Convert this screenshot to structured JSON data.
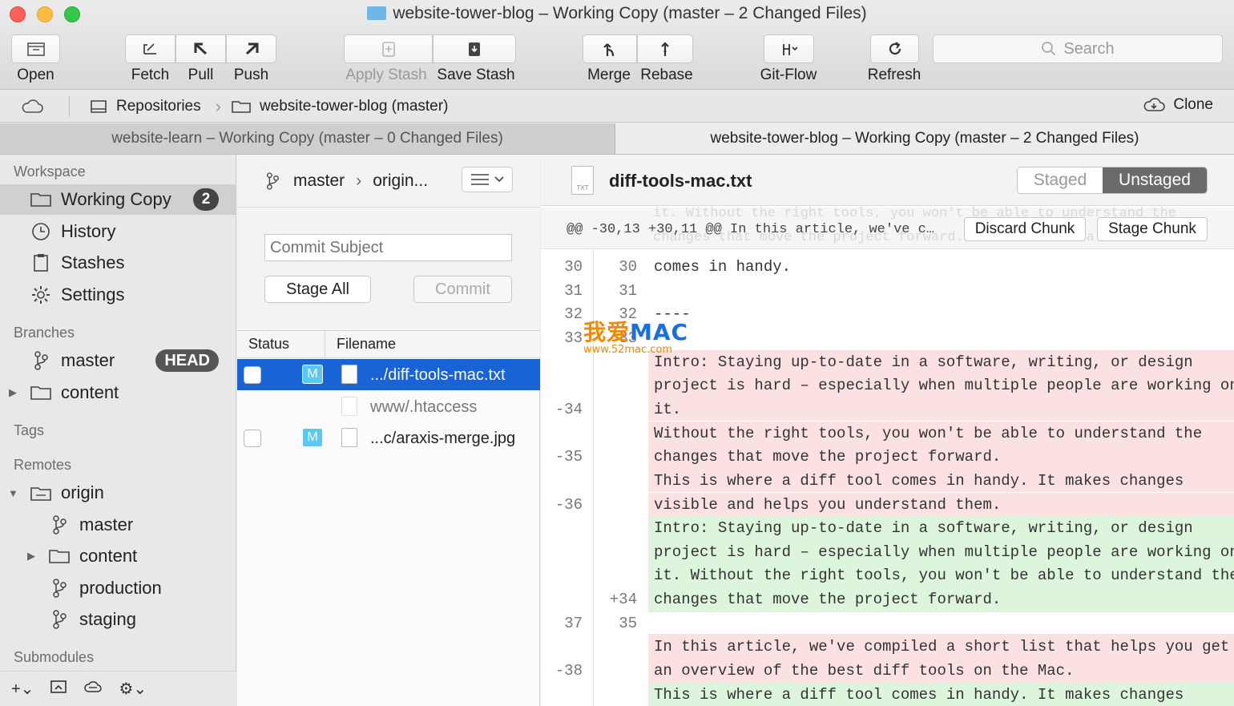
{
  "window": {
    "title": "website-tower-blog – Working Copy (master – 2 Changed Files)"
  },
  "toolbar": {
    "open": "Open",
    "fetch": "Fetch",
    "pull": "Pull",
    "push": "Push",
    "apply_stash": "Apply Stash",
    "save_stash": "Save Stash",
    "merge": "Merge",
    "rebase": "Rebase",
    "gitflow": "Git-Flow",
    "refresh": "Refresh",
    "search_placeholder": "Search"
  },
  "pathbar": {
    "repositories": "Repositories",
    "repo": "website-tower-blog (master)",
    "clone": "Clone"
  },
  "tabs": [
    {
      "label": "website-learn – Working Copy (master – 0 Changed Files)"
    },
    {
      "label": "website-tower-blog – Working Copy (master – 2 Changed Files)"
    }
  ],
  "sidebar": {
    "workspace_header": "Workspace",
    "working_copy": "Working Copy",
    "working_copy_count": "2",
    "history": "History",
    "stashes": "Stashes",
    "settings": "Settings",
    "branches_header": "Branches",
    "branch_master": "master",
    "head_badge": "HEAD",
    "branch_content": "content",
    "tags_header": "Tags",
    "remotes_header": "Remotes",
    "remote_origin": "origin",
    "remote_master": "master",
    "remote_content": "content",
    "remote_production": "production",
    "remote_staging": "staging",
    "submodules_header": "Submodules"
  },
  "middle": {
    "branch": "master",
    "upstream": "origin...",
    "commit_subject_placeholder": "Commit Subject",
    "stage_all": "Stage All",
    "commit": "Commit",
    "col_status": "Status",
    "col_filename": "Filename",
    "files": [
      {
        "status": "M",
        "name": ".../diff-tools-mac.txt"
      },
      {
        "status": "",
        "name": "www/.htaccess"
      },
      {
        "status": "M",
        "name": "...c/araxis-merge.jpg"
      }
    ]
  },
  "diff": {
    "filename": "diff-tools-mac.txt",
    "file_type": "TXT",
    "staged": "Staged",
    "unstaged": "Unstaged",
    "hunk_header": "@@ -30,13 +30,11 @@ In this article, we've c…",
    "hunk_ghost_1": "it. Without the right tools, you won't be able to understand the",
    "hunk_ghost_2": "changes that move the project forward. This is where a diff tool",
    "discard_chunk": "Discard Chunk",
    "stage_chunk": "Stage Chunk",
    "lines": [
      {
        "type": "ctx",
        "old": "30",
        "new": "30",
        "text": "comes in handy."
      },
      {
        "type": "ctx",
        "old": "31",
        "new": "31",
        "text": ""
      },
      {
        "type": "ctx",
        "old": "32",
        "new": "32",
        "text": "----"
      },
      {
        "type": "ctx",
        "old": "33",
        "new": "33",
        "text": ""
      },
      {
        "type": "del",
        "old": "",
        "new": "",
        "text": "Intro: Staying up-to-date in a software, writing, or design"
      },
      {
        "type": "del",
        "old": "",
        "new": "",
        "text": "project is hard – especially when multiple people are working on"
      },
      {
        "type": "del",
        "old": "-34",
        "new": "",
        "text": "it."
      },
      {
        "type": "del",
        "old": "",
        "new": "",
        "text": "Without the right tools, you won't be able to understand the"
      },
      {
        "type": "del",
        "old": "-35",
        "new": "",
        "text": "changes that move the project forward."
      },
      {
        "type": "del",
        "old": "",
        "new": "",
        "text": "This is where a diff tool comes in handy. It makes changes"
      },
      {
        "type": "del",
        "old": "-36",
        "new": "",
        "text": "visible and helps you understand them."
      },
      {
        "type": "add",
        "old": "",
        "new": "",
        "text": "Intro: Staying up-to-date in a software, writing, or design"
      },
      {
        "type": "add",
        "old": "",
        "new": "",
        "text": "project is hard – especially when multiple people are working on"
      },
      {
        "type": "add",
        "old": "",
        "new": "",
        "text": "it. Without the right tools, you won't be able to understand the"
      },
      {
        "type": "add",
        "old": "",
        "new": "+34",
        "text": "changes that move the project forward."
      },
      {
        "type": "sep",
        "old": "37",
        "new": "35",
        "text": ""
      },
      {
        "type": "del",
        "old": "",
        "new": "",
        "text": "In this article, we've compiled a short list that helps you get"
      },
      {
        "type": "del",
        "old": "-38",
        "new": "",
        "text": "an overview of the best diff tools on the Mac."
      },
      {
        "type": "add",
        "old": "",
        "new": "",
        "text": "This is where a diff tool comes in handy. It makes changes"
      }
    ]
  },
  "watermark": {
    "brand_cn": "我爱",
    "brand": "MAC",
    "url": "www.52mac.com"
  }
}
